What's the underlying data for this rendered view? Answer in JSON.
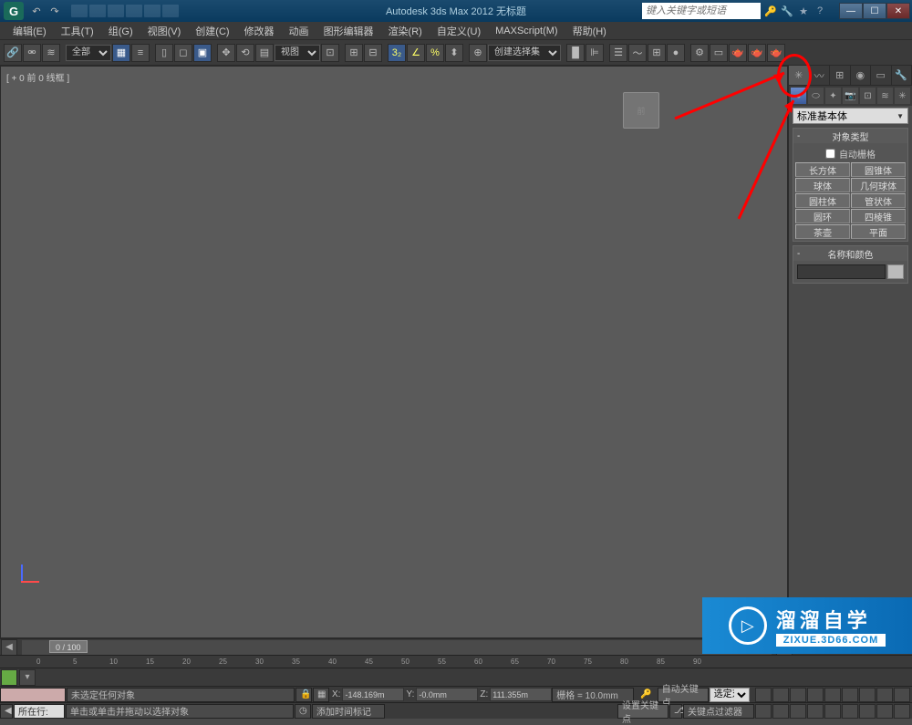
{
  "title": "Autodesk 3ds Max 2012     无标题",
  "search_placeholder": "键入关键字或短语",
  "menu": [
    "编辑(E)",
    "工具(T)",
    "组(G)",
    "视图(V)",
    "创建(C)",
    "修改器",
    "动画",
    "图形编辑器",
    "渲染(R)",
    "自定义(U)",
    "MAXScript(M)",
    "帮助(H)"
  ],
  "toolbar": {
    "filter_dropdown": "全部",
    "view_dropdown": "视图",
    "selset_placeholder": "创建选择集"
  },
  "viewport": {
    "label": "[ + 0 前 0 线框 ]",
    "cube": "前"
  },
  "panel": {
    "dropdown": "标准基本体",
    "rollout1_title": "对象类型",
    "auto_grid": "自动栅格",
    "buttons": [
      [
        "长方体",
        "圆锥体"
      ],
      [
        "球体",
        "几何球体"
      ],
      [
        "圆柱体",
        "管状体"
      ],
      [
        "圆环",
        "四棱锥"
      ],
      [
        "茶壶",
        "平面"
      ]
    ],
    "rollout2_title": "名称和颜色"
  },
  "timeline": {
    "slider": "0 / 100",
    "ticks": [
      "0",
      "5",
      "10",
      "15",
      "20",
      "25",
      "30",
      "35",
      "40",
      "45",
      "50",
      "55",
      "60",
      "65",
      "70",
      "75",
      "80",
      "85",
      "90"
    ]
  },
  "status": {
    "no_selection": "未选定任何对象",
    "hint": "单击或单击并拖动以选择对象",
    "row_label": "所在行:",
    "add_time_tag": "添加时间标记",
    "x_label": "X:",
    "x_val": "-148.169m",
    "y_label": "Y:",
    "y_val": "-0.0mm",
    "z_label": "Z:",
    "z_val": "111.355m",
    "grid": "栅格 = 10.0mm",
    "auto_key": "自动关键点",
    "sel_key": "选定对象",
    "set_key": "设置关键点",
    "key_filter": "关键点过滤器"
  },
  "watermark": {
    "main": "溜溜自学",
    "url": "ZIXUE.3D66.COM"
  }
}
